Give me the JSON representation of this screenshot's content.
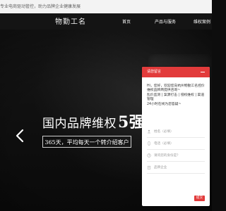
{
  "topbar": {
    "text": "专业电商驱动管控，助力品牌企业健康发展"
  },
  "header": {
    "brand": "物勤工名",
    "nav": [
      "首页",
      "产品与服务",
      "维权案例"
    ]
  },
  "hero": {
    "headline_main": "国内品牌维权",
    "headline_strong": "5强",
    "subheadline": "365天，平均每天一个转介绍客户"
  },
  "chat": {
    "title": "请您留言",
    "message": "Hi，您好，欢迎您向杭州物勤工名控价维权品牌商提供咨询~\n乱价监测 | 案源打击 | 侵权维权 | 渠道管理\n24小时在线为您答疑~",
    "fields": [
      {
        "placeholder": "姓名（必填）",
        "icon": "user-icon"
      },
      {
        "placeholder": "电话（必填）",
        "icon": "phone-icon"
      },
      {
        "placeholder": "请问您的身份是？",
        "icon": "question-icon"
      },
      {
        "placeholder": "品牌企业",
        "icon": "building-icon"
      }
    ],
    "submit": "提交"
  },
  "colors": {
    "accent": "#e23b3b",
    "header_bg": "#141414",
    "topbar_bg": "#f3f3f3"
  }
}
